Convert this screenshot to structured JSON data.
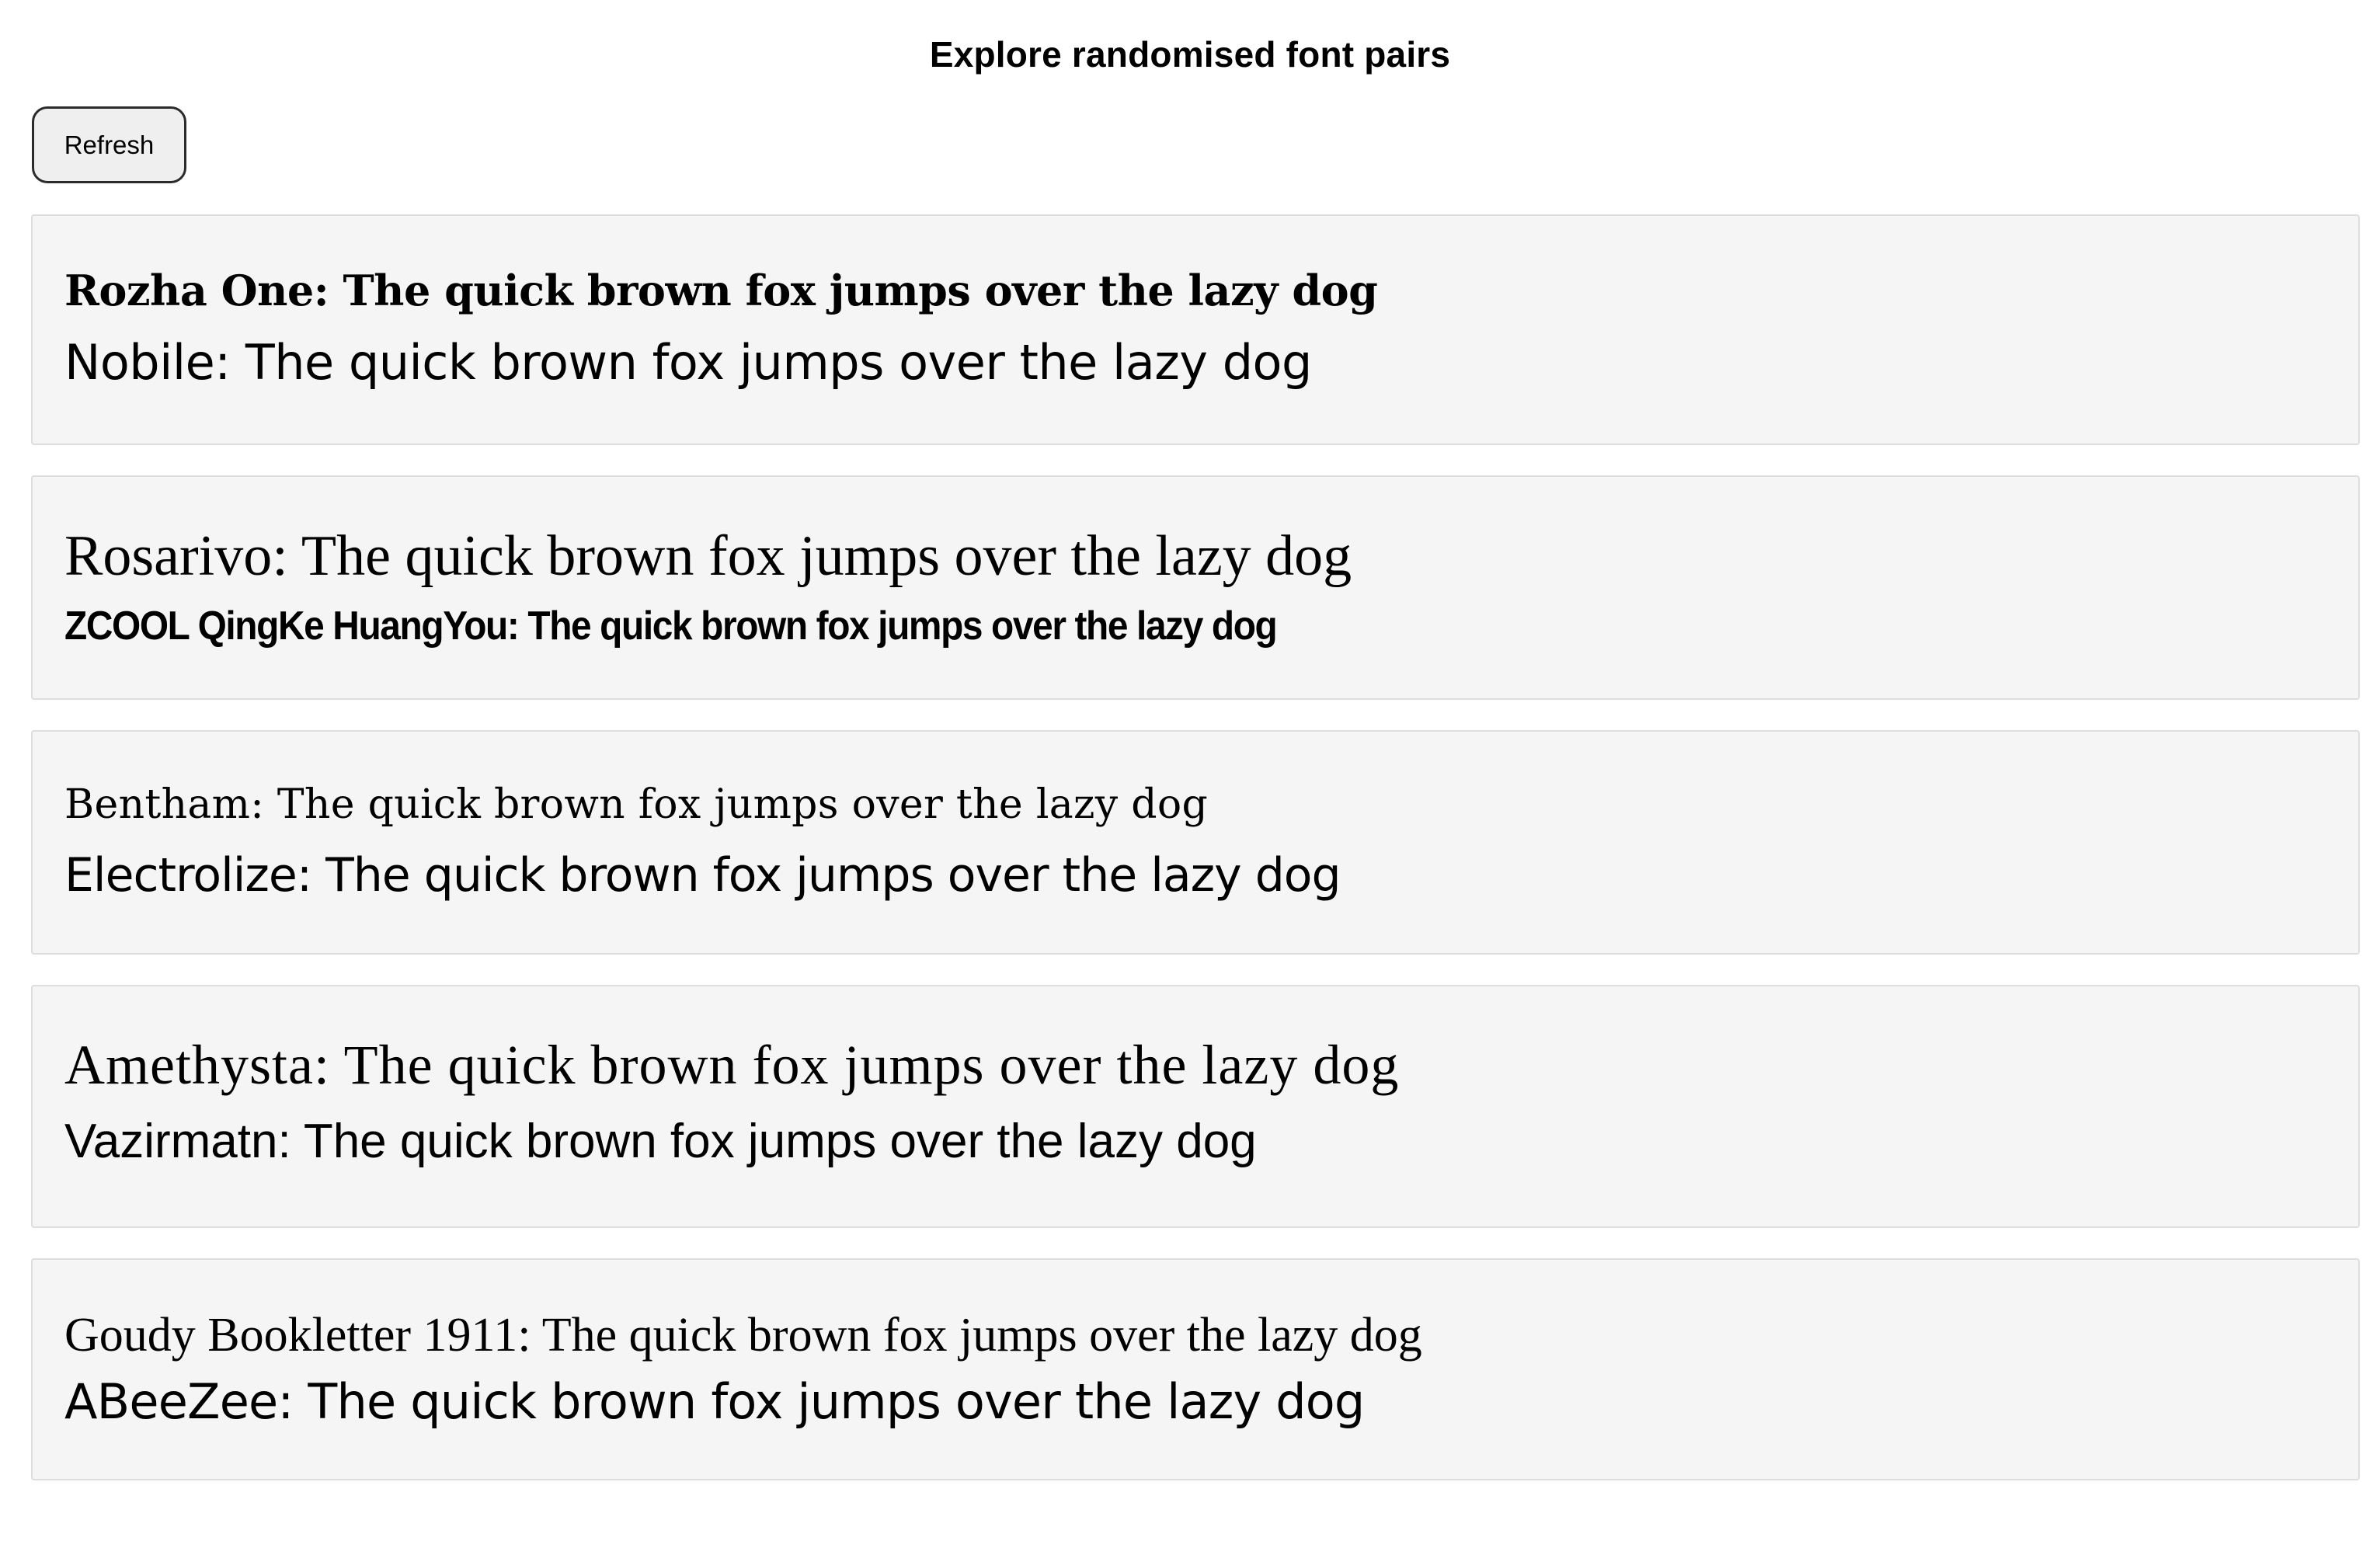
{
  "header": {
    "title": "Explore randomised font pairs"
  },
  "toolbar": {
    "refresh_label": "Refresh"
  },
  "pairs": [
    {
      "first": "Rozha One: The quick brown fox jumps over the lazy dog",
      "second": "Nobile: The quick brown fox jumps over the lazy dog"
    },
    {
      "first": "Rosarivo: The quick brown fox jumps over the lazy dog",
      "second": "ZCOOL QingKe HuangYou: The quick brown fox jumps over the lazy dog"
    },
    {
      "first": "Bentham: The quick brown fox jumps over the lazy dog",
      "second": "Electrolize: The quick brown fox jumps over the lazy dog"
    },
    {
      "first": "Amethysta: The quick brown fox jumps over the lazy dog",
      "second": "Vazirmatn: The quick brown fox jumps over the lazy dog"
    },
    {
      "first": "Goudy Bookletter 1911: The quick brown fox jumps over the lazy dog",
      "second": "ABeeZee: The quick brown fox jumps over the lazy dog"
    }
  ],
  "colors": {
    "card_background": "#f5f5f5",
    "card_border": "#dddddd",
    "button_background": "#efefef",
    "button_border": "#2b2b2b"
  }
}
